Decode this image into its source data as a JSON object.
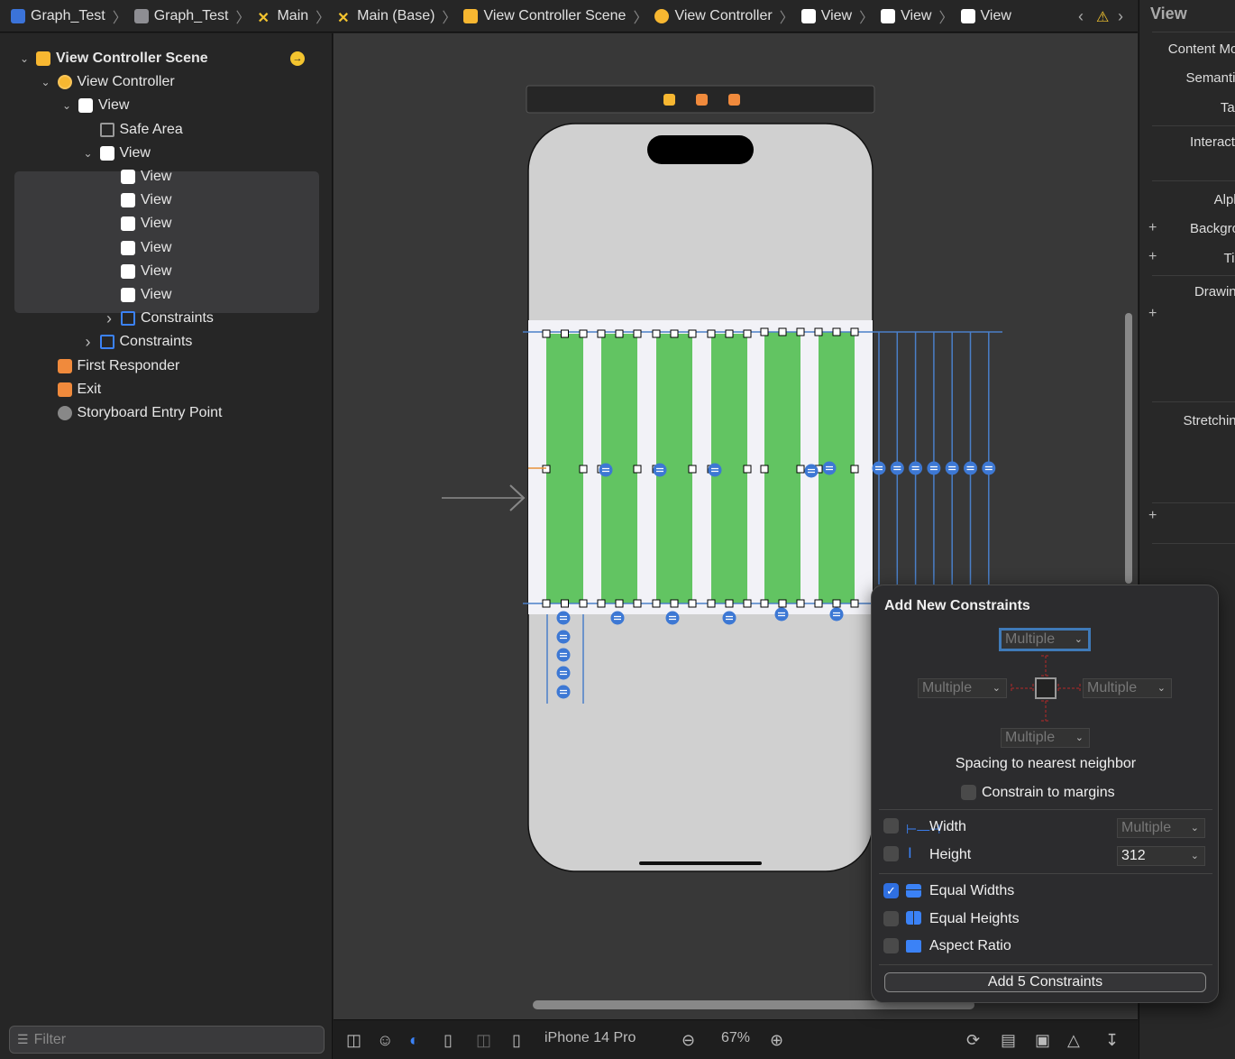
{
  "breadcrumb": [
    {
      "label": "Graph_Test",
      "icon": "app-project-icon",
      "color": "#3b73d9"
    },
    {
      "label": "Graph_Test",
      "icon": "folder-icon",
      "color": "#8e8e93"
    },
    {
      "label": "Main",
      "icon": "storyboard-icon",
      "color": "#f3c42f"
    },
    {
      "label": "Main (Base)",
      "icon": "storyboard-icon",
      "color": "#f3c42f"
    },
    {
      "label": "View Controller Scene",
      "icon": "scene-icon",
      "color": "#f7b731"
    },
    {
      "label": "View Controller",
      "icon": "view-controller-icon",
      "color": "#f7b731"
    },
    {
      "label": "View",
      "icon": "view-icon",
      "color": "#ffffff"
    },
    {
      "label": "View",
      "icon": "view-icon",
      "color": "#ffffff"
    },
    {
      "label": "View",
      "icon": "view-icon",
      "color": "#ffffff"
    }
  ],
  "navigator": {
    "items": [
      {
        "label": "View Controller Scene",
        "level": 0,
        "chevron": "down",
        "icon": "scene-icon",
        "bold": true
      },
      {
        "label": "View Controller",
        "level": 1,
        "chevron": "down",
        "icon": "view-controller-icon"
      },
      {
        "label": "View",
        "level": 2,
        "chevron": "down",
        "icon": "view-icon"
      },
      {
        "label": "Safe Area",
        "level": 3,
        "chevron": "",
        "icon": "safe-area-icon"
      },
      {
        "label": "View",
        "level": 3,
        "chevron": "down",
        "icon": "view-icon"
      },
      {
        "label": "View",
        "level": 4,
        "chevron": "",
        "icon": "view-icon"
      },
      {
        "label": "View",
        "level": 4,
        "chevron": "",
        "icon": "view-icon"
      },
      {
        "label": "View",
        "level": 4,
        "chevron": "",
        "icon": "view-icon"
      },
      {
        "label": "View",
        "level": 4,
        "chevron": "",
        "icon": "view-icon"
      },
      {
        "label": "View",
        "level": 4,
        "chevron": "",
        "icon": "view-icon"
      },
      {
        "label": "View",
        "level": 4,
        "chevron": "",
        "icon": "view-icon"
      },
      {
        "label": "Constraints",
        "level": 4,
        "chevron": "right",
        "icon": "constraints-icon"
      },
      {
        "label": "Constraints",
        "level": 3,
        "chevron": "right",
        "icon": "constraints-icon"
      },
      {
        "label": "First Responder",
        "level": 1,
        "chevron": "",
        "icon": "first-responder-icon"
      },
      {
        "label": "Exit",
        "level": 1,
        "chevron": "",
        "icon": "exit-icon"
      },
      {
        "label": "Storyboard Entry Point",
        "level": 1,
        "chevron": "",
        "icon": "entry-point-icon"
      }
    ],
    "filter_placeholder": "Filter"
  },
  "inspector": {
    "title": "View",
    "labels": [
      "Content Mode",
      "Semantic",
      "Tag",
      "Interaction",
      "Alpha",
      "Background",
      "Tint",
      "Drawing",
      "Stretching"
    ]
  },
  "canvas": {
    "bar_color": "#62c462",
    "bar_count": 6
  },
  "bottom_bar": {
    "device": "iPhone 14 Pro",
    "zoom": "67%"
  },
  "popover": {
    "title": "Add New Constraints",
    "top": "Multiple",
    "left": "Multiple",
    "right": "Multiple",
    "bottom": "Multiple",
    "spacing_label": "Spacing to nearest neighbor",
    "constrain_margins": {
      "label": "Constrain to margins",
      "checked": false
    },
    "width": {
      "label": "Width",
      "value": "Multiple",
      "checked": false
    },
    "height": {
      "label": "Height",
      "value": "312",
      "checked": false
    },
    "equal_widths": {
      "label": "Equal Widths",
      "checked": true
    },
    "equal_heights": {
      "label": "Equal Heights",
      "checked": false
    },
    "aspect_ratio": {
      "label": "Aspect Ratio",
      "checked": false
    },
    "add_button": "Add 5 Constraints"
  }
}
